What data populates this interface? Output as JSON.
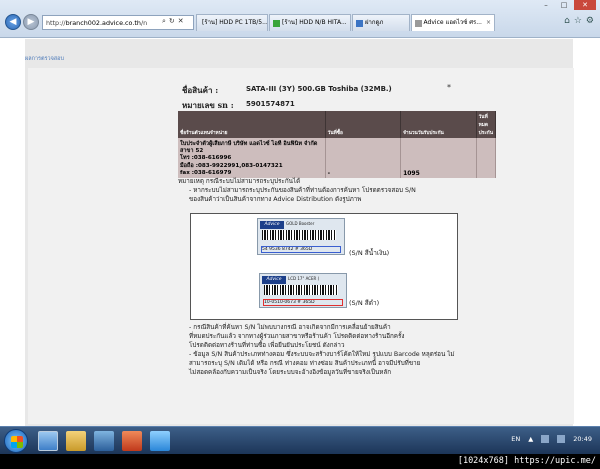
{
  "browser": {
    "address": "http://branch002.advice.co.th/n",
    "address_host_prefix": "http://",
    "address_host": "branch002.advice.co.th",
    "address_rest": "/n",
    "address_search_glyph": "⌕",
    "address_refresh_glyph": "↻",
    "address_close_glyph": "✕",
    "tabs": [
      {
        "label": "[ร้าน] HDD PC 1TB/5...",
        "icon": "page-icon"
      },
      {
        "label": "[ร้าน] HDD N/B HITA...",
        "icon": "page-icon-green"
      },
      {
        "label": "ฝากดูภ",
        "icon": "page-icon-blue"
      },
      {
        "label": "Advice แอดไวซ์ ศร...",
        "icon": "page-icon-gray",
        "active": true
      }
    ],
    "tab_close_glyph": "×",
    "toolbar_glyphs": {
      "home": "⌂",
      "favorites": "☆",
      "settings": "⚙"
    },
    "window_glyphs": {
      "minimize": "–",
      "maximize": "□",
      "close": "✕"
    },
    "nav_glyphs": {
      "back": "◀",
      "forward": "▶"
    }
  },
  "page": {
    "breadcrumb": "ผลการตรวจสอบ",
    "product_label": "ชื่อสินค้า :",
    "product_value": "SATA-III (3Y) 500.GB Toshiba (32MB.)",
    "serial_label": "หมายเลข sn :",
    "serial_value": "5901574871",
    "asterisk": "*",
    "table": {
      "headers": [
        "ชื่อร้านตัวแทนจำหน่าย",
        "วันที่ซื้อ",
        "จำนวนวันรับประกัน",
        "วันที่หมดประกัน"
      ],
      "row": {
        "address_line1": "ใบประจำตัวผู้เสียภาษี บริษัท แอดไวซ์ ไอที อินฟินิท จำกัด สาขา 52",
        "address_line2": "โทร :038-616996",
        "address_line3": "มือถือ :083-9922991,083-0147321",
        "address_line4": "fax :038-616979",
        "purchase_date": "-",
        "warranty_days": "1095",
        "expiry_date": ""
      }
    },
    "notes_top": [
      "หมายเหตุ กรณีระบบไม่สามารถระบุประกันได้",
      "- หากระบบไม่สามารถระบุประกันของสินค้าที่ท่านต้องการค้นหา โปรดตรวจสอบ S/N",
      "ของสินค้าว่าเป็นสินค้าจากทาง Advice Distribution ดังรูปภาพ"
    ],
    "samples": [
      {
        "brand": "Advice",
        "top_text": "GOLD Booster",
        "mid_text": "DC 12V 5A 12V NL22",
        "serial": "54 9536 8742 # 365D",
        "caption": "(S/N สีน้ำเงิน)"
      },
      {
        "brand": "Advice",
        "top_text": "LCD 17\" ACER (",
        "mid_text": "17\"W Square D",
        "serial": "10-0510-0673 # 365D",
        "caption": "(S/N สีดำ)"
      }
    ],
    "notes_bottom": [
      "- กรณีสินค้าที่ค้นหา S/N ไม่พบบางกรณี อาจเกิดจากมีการเคลื่อนย้ายสินค้า",
      "ที่หมดประกันแล้ว จากทางผู้ร่วมภายสาขาหรือร้านค้า โปรดติดต่อทางร้านอีกครั้ง",
      "โปรดติดต่อทางร้านที่ท่านซื้อ เพื่อยืนยันประโยชน์ ดังกล่าว",
      "- ข้อมูล S/N สินค้าประเภทท่างคอม ซึ่งระบบจะสร้างบาร์โค้ดให้ใหม่ รูปแบบ Barcode หลุดร่อน ไม่",
      "สามารถระบุ S/N เดิมได้ หรือ กรณี ท่างคอม ท่างซ่อม สินค้าประเภทนี้ อาจมีปรับที่ขาย",
      "ไม่สอดคล้องกับความเป็นจริง โดยระบบจะอ้างอิงข้อมูลวันที่ขายจริงเป็นหลัก"
    ]
  },
  "taskbar": {
    "language": "EN",
    "time": "20:49",
    "tray_expand_glyph": "▲"
  },
  "watermark": "[1024x768] https://upic.me/"
}
